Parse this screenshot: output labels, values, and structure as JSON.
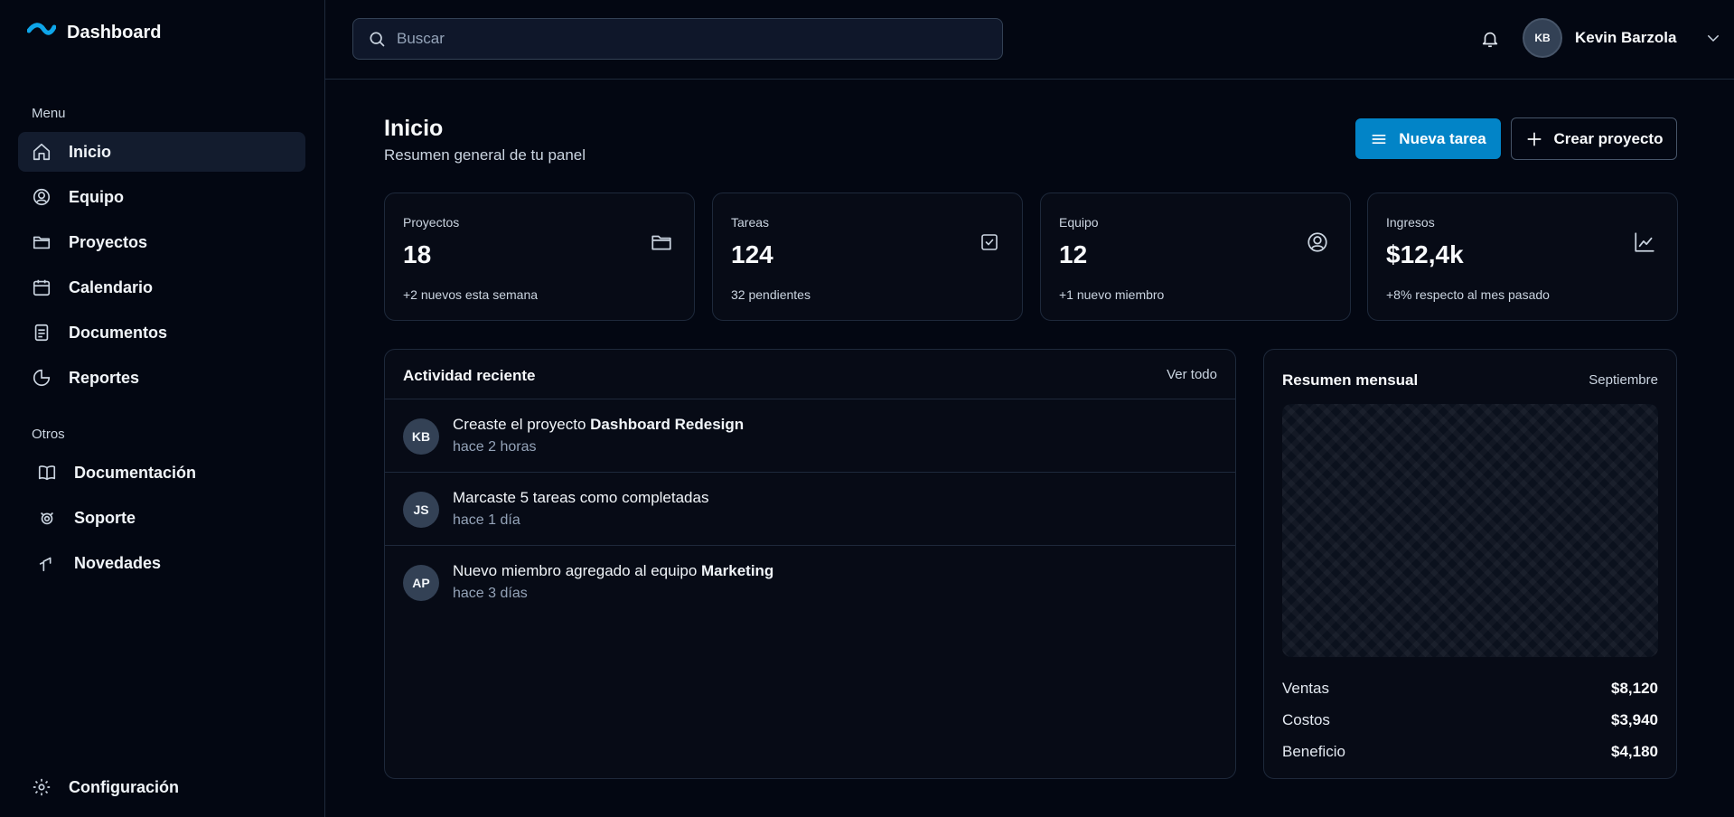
{
  "brand": {
    "title": "Dashboard",
    "icon": "wave-logo-icon",
    "accent": "#0ea5e9"
  },
  "sidebar": {
    "menu_label": "Menu",
    "menu_items": [
      {
        "label": "Inicio",
        "icon": "home-icon",
        "active": true
      },
      {
        "label": "Equipo",
        "icon": "team-icon"
      },
      {
        "label": "Proyectos",
        "icon": "folder-icon"
      },
      {
        "label": "Calendario",
        "icon": "calendar-icon"
      },
      {
        "label": "Documentos",
        "icon": "document-icon"
      },
      {
        "label": "Reportes",
        "icon": "pie-chart-icon"
      }
    ],
    "other_label": "Otros",
    "other_items": [
      {
        "label": "Documentación",
        "icon": "book-icon"
      },
      {
        "label": "Soporte",
        "icon": "support-icon"
      },
      {
        "label": "Novedades",
        "icon": "news-icon"
      }
    ],
    "settings_label": "Configuración"
  },
  "topbar": {
    "search_placeholder": "Buscar",
    "user": {
      "initials": "KB",
      "name": "Kevin Barzola"
    }
  },
  "page": {
    "title": "Inicio",
    "subtitle": "Resumen general de tu panel",
    "primary_button": "Nueva tarea",
    "secondary_button": "Crear proyecto",
    "primary_color": "#0284c7"
  },
  "stats": [
    {
      "label": "Proyectos",
      "value": "18",
      "note": "+2 nuevos esta semana",
      "icon": "folder-icon"
    },
    {
      "label": "Tareas",
      "value": "124",
      "note": "32 pendientes",
      "icon": "checkbox-icon"
    },
    {
      "label": "Equipo",
      "value": "12",
      "note": "+1 nuevo miembro",
      "icon": "team-icon"
    },
    {
      "label": "Ingresos",
      "value": "$12,4k",
      "note": "+8% respecto al mes pasado",
      "icon": "line-chart-icon"
    }
  ],
  "activity": {
    "title": "Actividad reciente",
    "see_all": "Ver todo",
    "items": [
      {
        "initials": "KB",
        "text": "Creaste el proyecto ",
        "bold": "Dashboard Redesign",
        "time": "hace 2 horas"
      },
      {
        "initials": "JS",
        "text": "Marcaste 5 tareas como completadas",
        "bold": "",
        "time": "hace 1 día"
      },
      {
        "initials": "AP",
        "text": "Nuevo miembro agregado al equipo ",
        "bold": "Marketing",
        "time": "hace 3 días"
      }
    ]
  },
  "monthly": {
    "title": "Resumen mensual",
    "month": "Septiembre",
    "rows": [
      {
        "label": "Ventas",
        "value": "$8,120"
      },
      {
        "label": "Costos",
        "value": "$3,940"
      },
      {
        "label": "Beneficio",
        "value": "$4,180"
      }
    ]
  }
}
